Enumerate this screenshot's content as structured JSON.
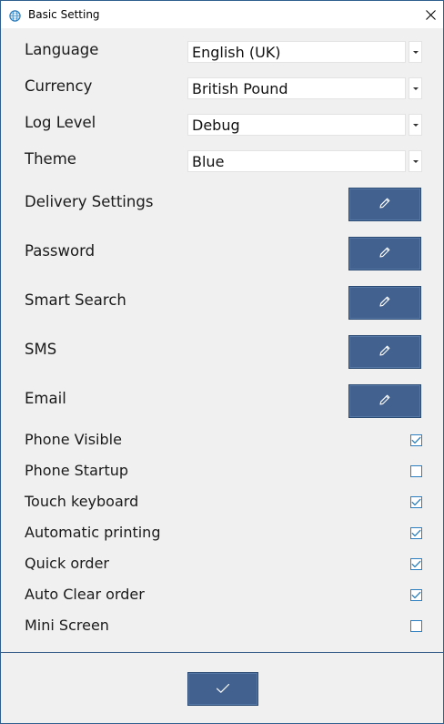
{
  "window": {
    "title": "Basic Setting",
    "accent_color": "#42618f",
    "checkbox_color": "#2b7fc0",
    "icons": {
      "app": "globe-icon",
      "close": "close-icon",
      "edit": "pencil-icon",
      "confirm": "checkmark-icon"
    }
  },
  "dropdowns": [
    {
      "label": "Language",
      "value": "English (UK)"
    },
    {
      "label": "Currency",
      "value": "British Pound"
    },
    {
      "label": "Log Level",
      "value": "Debug"
    },
    {
      "label": "Theme",
      "value": "Blue"
    }
  ],
  "edit_rows": [
    {
      "label": "Delivery Settings"
    },
    {
      "label": "Password"
    },
    {
      "label": "Smart Search"
    },
    {
      "label": "SMS"
    },
    {
      "label": "Email"
    }
  ],
  "checkboxes": [
    {
      "label": "Phone Visible",
      "checked": true
    },
    {
      "label": "Phone Startup",
      "checked": false
    },
    {
      "label": "Touch keyboard",
      "checked": true
    },
    {
      "label": "Automatic printing",
      "checked": true
    },
    {
      "label": "Quick order",
      "checked": true
    },
    {
      "label": "Auto Clear order",
      "checked": true
    },
    {
      "label": "Mini Screen",
      "checked": false
    }
  ]
}
